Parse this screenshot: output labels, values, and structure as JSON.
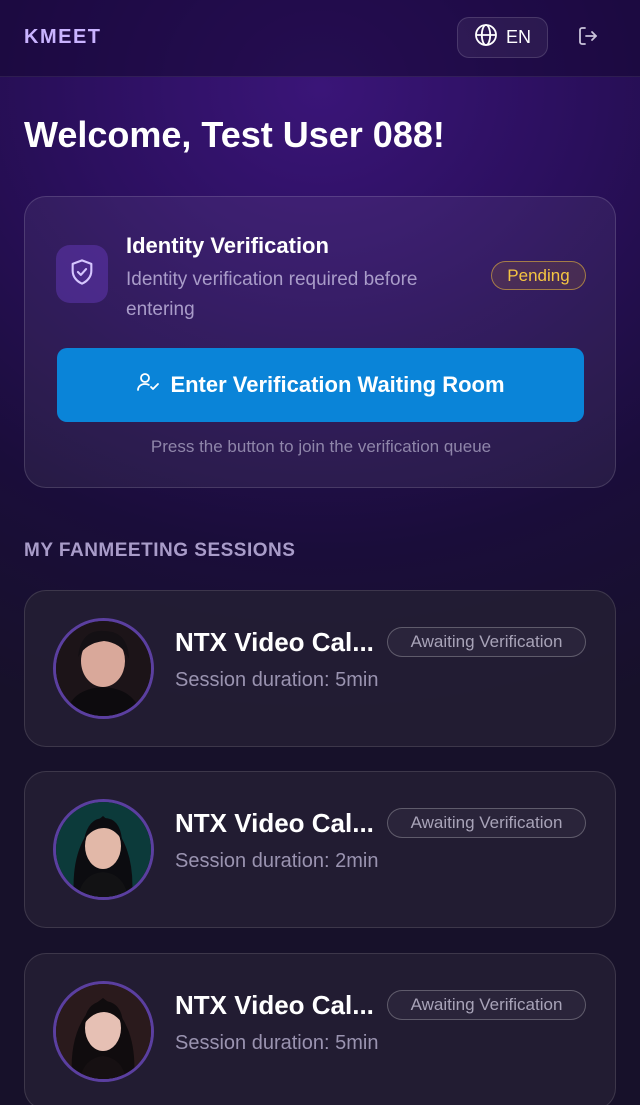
{
  "header": {
    "logo": "KMEET",
    "lang_label": "EN"
  },
  "welcome": "Welcome, Test User 088!",
  "verification": {
    "title": "Identity Verification",
    "description": "Identity verification required before entering",
    "status": "Pending",
    "button_label": "Enter Verification Waiting Room",
    "hint": "Press the button to join the verification queue"
  },
  "sessions_title": "MY FANMEETING SESSIONS",
  "sessions": [
    {
      "title": "NTX Video Cal...",
      "status": "Awaiting Verification",
      "duration": "Session duration: 5min"
    },
    {
      "title": "NTX Video Cal...",
      "status": "Awaiting Verification",
      "duration": "Session duration: 2min"
    },
    {
      "title": "NTX Video Cal...",
      "status": "Awaiting Verification",
      "duration": "Session duration: 5min"
    }
  ],
  "colors": {
    "accent_button": "#0a84d8",
    "pending": "#f5c542",
    "logo": "#c9b3ff",
    "background": "#2a0f5c"
  },
  "icons": [
    "globe-icon",
    "logout-icon",
    "shield-check-icon",
    "user-check-icon"
  ]
}
